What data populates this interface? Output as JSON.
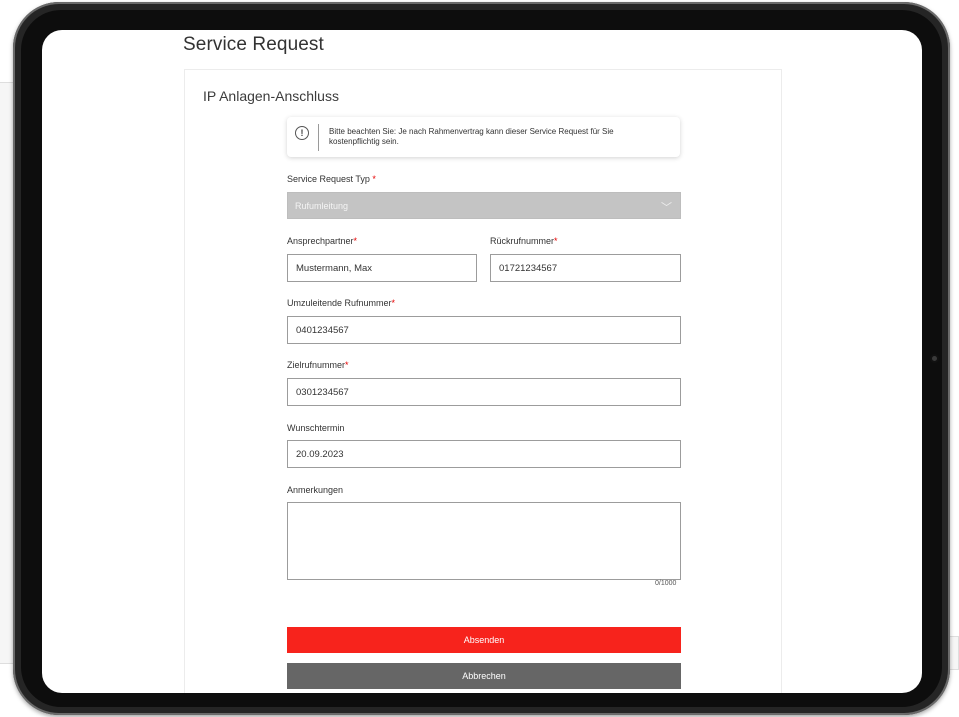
{
  "page": {
    "title": "Service Request",
    "card_title": "IP Anlagen-Anschluss"
  },
  "notice": {
    "icon": "info-circle-icon",
    "line1": "Bitte beachten Sie: Je nach Rahmenvertrag kann dieser Service Request für Sie",
    "line2": "kostenpflichtig sein."
  },
  "form": {
    "required_marker": "*",
    "type": {
      "label": "Service Request Typ",
      "value": "Rufumleitung",
      "icon": "chevron-down-icon"
    },
    "contact": {
      "label": "Ansprechpartner",
      "value": "Mustermann, Max"
    },
    "callback": {
      "label": "Rückrufnummer",
      "value": "01721234567"
    },
    "forward_number": {
      "label": "Umzuleitende Rufnummer",
      "value": "0401234567"
    },
    "target_number": {
      "label": "Zielrufnummer",
      "value": "0301234567"
    },
    "date": {
      "label": "Wunschtermin",
      "value": "20.09.2023"
    },
    "remarks": {
      "label": "Anmerkungen",
      "value": "",
      "counter": "0/1000"
    }
  },
  "buttons": {
    "submit": "Absenden",
    "cancel": "Abbrechen"
  },
  "colors": {
    "accent": "#f7231c",
    "secondary": "#666666",
    "required": "#e60000"
  }
}
